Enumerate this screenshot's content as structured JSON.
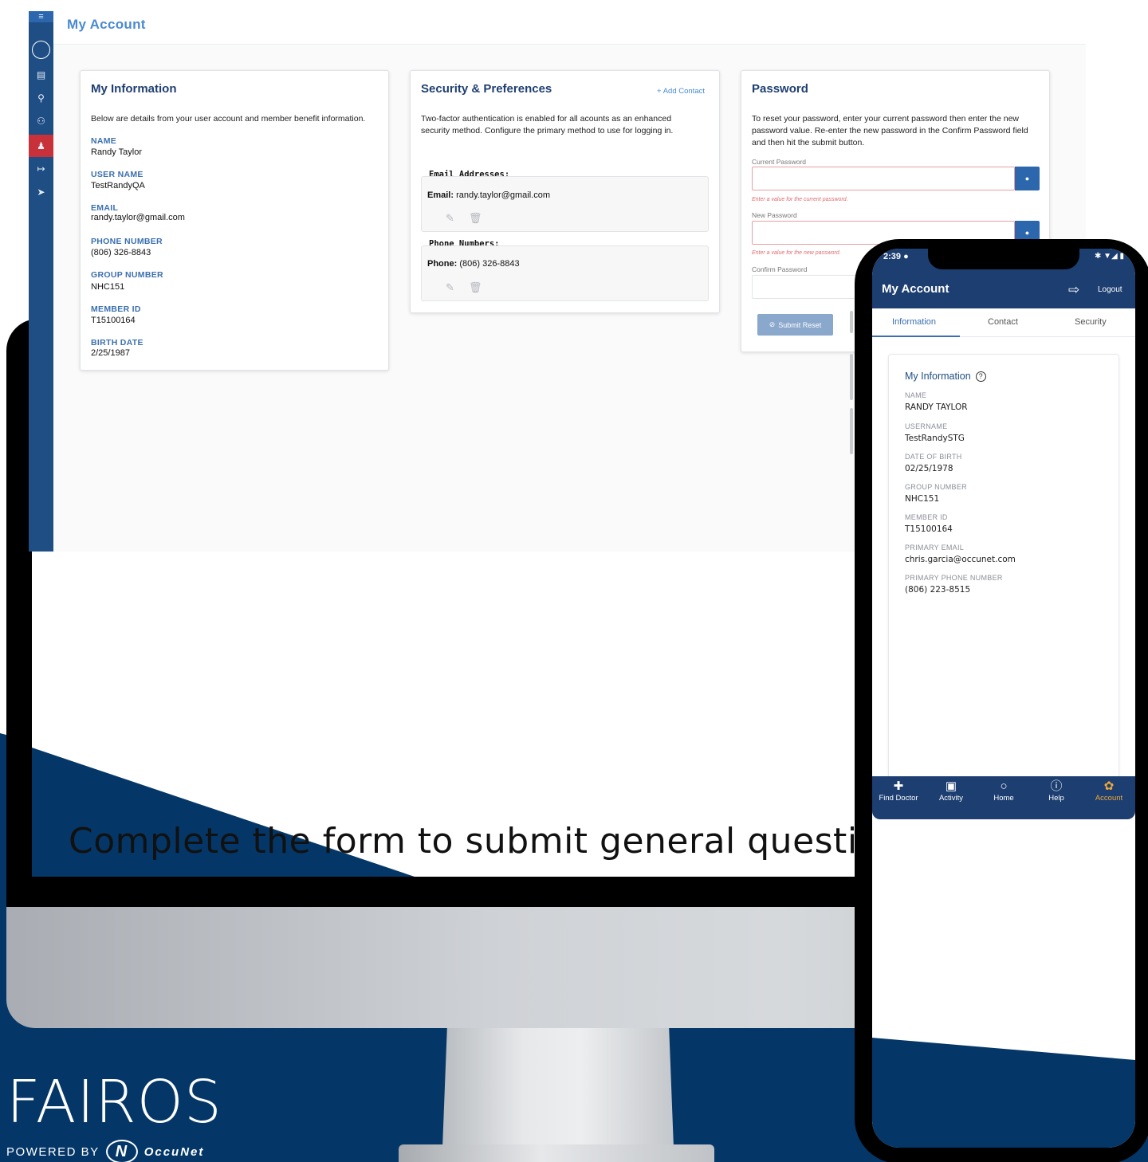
{
  "tagline": "Complete the form to submit general questions.",
  "brand": {
    "word": "FAIROS",
    "powered_by": "POWERED BY",
    "occunet": "OccuNet",
    "colors": {
      "navy": "#043767",
      "accent": "#2c67ad",
      "active_nav": "#f2a93b",
      "active_sidebar": "#c8303a"
    }
  },
  "desktop": {
    "header_title": "My Account",
    "sidebar_icons": [
      "menu-icon",
      "circle-logo-icon",
      "document-icon",
      "search-icon",
      "family-icon",
      "user-icon",
      "login-icon",
      "send-icon"
    ],
    "info_card": {
      "title": "My Information",
      "desc": "Below are details from your user account and member benefit information.",
      "fields": [
        {
          "label": "NAME",
          "value": "Randy Taylor"
        },
        {
          "label": "USER NAME",
          "value": "TestRandyQA"
        },
        {
          "label": "EMAIL",
          "value": "randy.taylor@gmail.com"
        },
        {
          "label": "PHONE NUMBER",
          "value": "(806) 326-8843"
        },
        {
          "label": "GROUP NUMBER",
          "value": "NHC151"
        },
        {
          "label": "MEMBER ID",
          "value": "T15100164"
        },
        {
          "label": "BIRTH DATE",
          "value": "2/25/1987"
        }
      ]
    },
    "security_card": {
      "title": "Security & Preferences",
      "add_contact": "+ Add Contact",
      "desc": "Two-factor authentication is enabled for all acounts as an enhanced security method. Configure the primary method to use for logging in.",
      "email_head": "Email Addresses:",
      "email_label": "Email:",
      "email_value": "randy.taylor@gmail.com",
      "phone_head": "Phone Numbers:",
      "phone_label": "Phone:",
      "phone_value": "(806) 326-8843"
    },
    "password_card": {
      "title": "Password",
      "desc": "To reset your password, enter your current password then enter the new password value. Re-enter the new password in the Confirm Password field and then hit the submit button.",
      "current_label": "Current Password",
      "current_error": "Enter a value for the current password.",
      "new_label": "New Password",
      "new_error": "Enter a value for the new password.",
      "confirm_label": "Confirm Password",
      "submit": "Submit Reset"
    }
  },
  "phone": {
    "status_time": "2:39",
    "title": "My Account",
    "logout": "Logout",
    "tabs": [
      "Information",
      "Contact",
      "Security"
    ],
    "active_tab": "Information",
    "card_title": "My Information",
    "fields": [
      {
        "label": "NAME",
        "value": "RANDY TAYLOR"
      },
      {
        "label": "USERNAME",
        "value": "TestRandySTG"
      },
      {
        "label": "DATE OF BIRTH",
        "value": "02/25/1978"
      },
      {
        "label": "GROUP NUMBER",
        "value": "NHC151"
      },
      {
        "label": "MEMBER ID",
        "value": "T15100164"
      },
      {
        "label": "PRIMARY EMAIL",
        "value": "chris.garcia@occunet.com"
      },
      {
        "label": "PRIMARY PHONE NUMBER",
        "value": "(806) 223-8515"
      }
    ],
    "nav": [
      {
        "label": "Find Doctor",
        "icon": "medical-bag-icon"
      },
      {
        "label": "Activity",
        "icon": "clipboard-icon"
      },
      {
        "label": "Home",
        "icon": "home-circle-icon"
      },
      {
        "label": "Help",
        "icon": "help-icon"
      },
      {
        "label": "Account",
        "icon": "account-gear-icon"
      }
    ],
    "active_nav": "Account"
  }
}
